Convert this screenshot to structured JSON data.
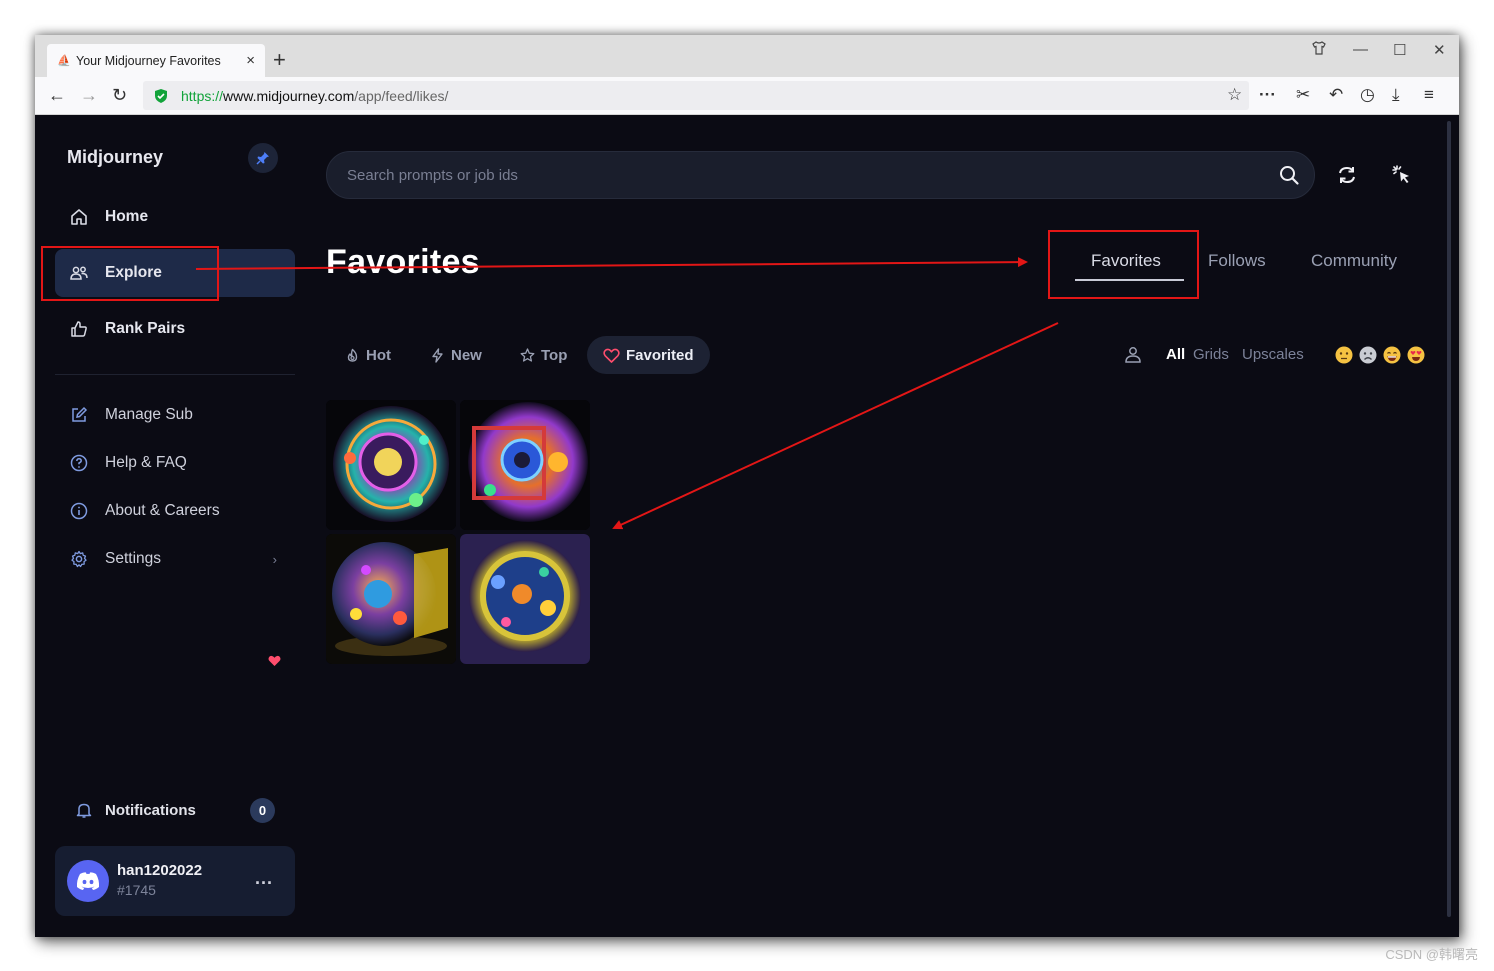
{
  "browser": {
    "tab_title": "Your Midjourney Favorites",
    "tab_close": "×",
    "new_tab": "+",
    "url_proto": "https://",
    "url_host": "www.midjourney.com",
    "url_path": "/app/feed/likes/"
  },
  "sidebar": {
    "brand": "Midjourney",
    "items": [
      {
        "label": "Home",
        "icon": "home-icon"
      },
      {
        "label": "Explore",
        "icon": "people-icon"
      },
      {
        "label": "Rank Pairs",
        "icon": "thumbs-up-icon"
      },
      {
        "label": "Manage Sub",
        "icon": "edit-icon"
      },
      {
        "label": "Help & FAQ",
        "icon": "help-icon"
      },
      {
        "label": "About & Careers",
        "icon": "info-icon"
      },
      {
        "label": "Settings",
        "icon": "gear-icon"
      }
    ],
    "notifications_label": "Notifications",
    "notifications_count": "0",
    "user": {
      "name": "han1202022",
      "tag": "#1745",
      "more": "..."
    }
  },
  "main": {
    "search_placeholder": "Search prompts or job ids",
    "title": "Favorites",
    "tabs": [
      "Favorites",
      "Follows",
      "Community"
    ],
    "active_tab": "Favorites",
    "filters": [
      {
        "label": "Hot",
        "icon": "flame-icon"
      },
      {
        "label": "New",
        "icon": "bolt-icon"
      },
      {
        "label": "Top",
        "icon": "star-icon"
      },
      {
        "label": "Favorited",
        "icon": "heart-icon"
      }
    ],
    "active_filter": "Favorited",
    "view_options": [
      "All",
      "Grids",
      "Upscales"
    ],
    "active_view": "All",
    "images_count": 4
  },
  "watermark": "CSDN @韩曙亮",
  "colors": {
    "background": "#0b0b14",
    "active_nav": "#1e2a48",
    "annotation": "#e31616",
    "discord": "#5865f2",
    "heart": "#ff4d6d"
  }
}
